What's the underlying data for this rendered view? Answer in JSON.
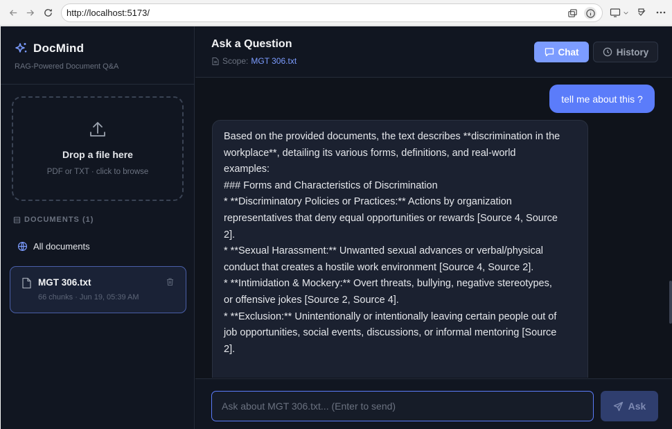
{
  "browser": {
    "url": "http://localhost:5173/"
  },
  "sidebar": {
    "brand_title": "DocMind",
    "brand_subtitle": "RAG-Powered Document Q&A",
    "dropzone_title": "Drop a file here",
    "dropzone_subtitle": "PDF or TXT · click to browse",
    "documents_label": "DOCUMENTS (1)",
    "all_documents_label": "All documents",
    "documents": [
      {
        "name": "MGT 306.txt",
        "meta": "66 chunks · Jun 19, 05:39 AM"
      }
    ]
  },
  "header": {
    "title": "Ask a Question",
    "scope_label": "Scope:",
    "scope_value": "MGT 306.txt",
    "tab_chat": "Chat",
    "tab_history": "History"
  },
  "chat": {
    "user_message": "tell me about this ?",
    "assistant_lines": [
      "Based on the provided documents, the text describes **discrimination in the",
      "workplace**, detailing its various forms, definitions, and real-world",
      "examples:",
      "",
      "### Forms and Characteristics of Discrimination",
      "* **Discriminatory Policies or Practices:** Actions by organization",
      "representatives that deny equal opportunities or rewards [Source 4, Source",
      "2].",
      "* **Sexual Harassment:** Unwanted sexual advances or verbal/physical",
      "conduct that creates a hostile work environment [Source 4, Source 2].",
      "* **Intimidation & Mockery:** Overt threats, bullying, negative stereotypes,",
      "or offensive jokes [Source 2, Source 4].",
      "* **Exclusion:** Unintentionally or intentionally leaving certain people out of",
      "job opportunities, social events, discussions, or informal mentoring [Source",
      "2]."
    ]
  },
  "input": {
    "placeholder": "Ask about MGT 306.txt... (Enter to send)",
    "value": "",
    "ask_label": "Ask"
  },
  "colors": {
    "accent": "#7c9cff",
    "user_bubble": "#5b7cfa",
    "background": "#0f131b"
  }
}
